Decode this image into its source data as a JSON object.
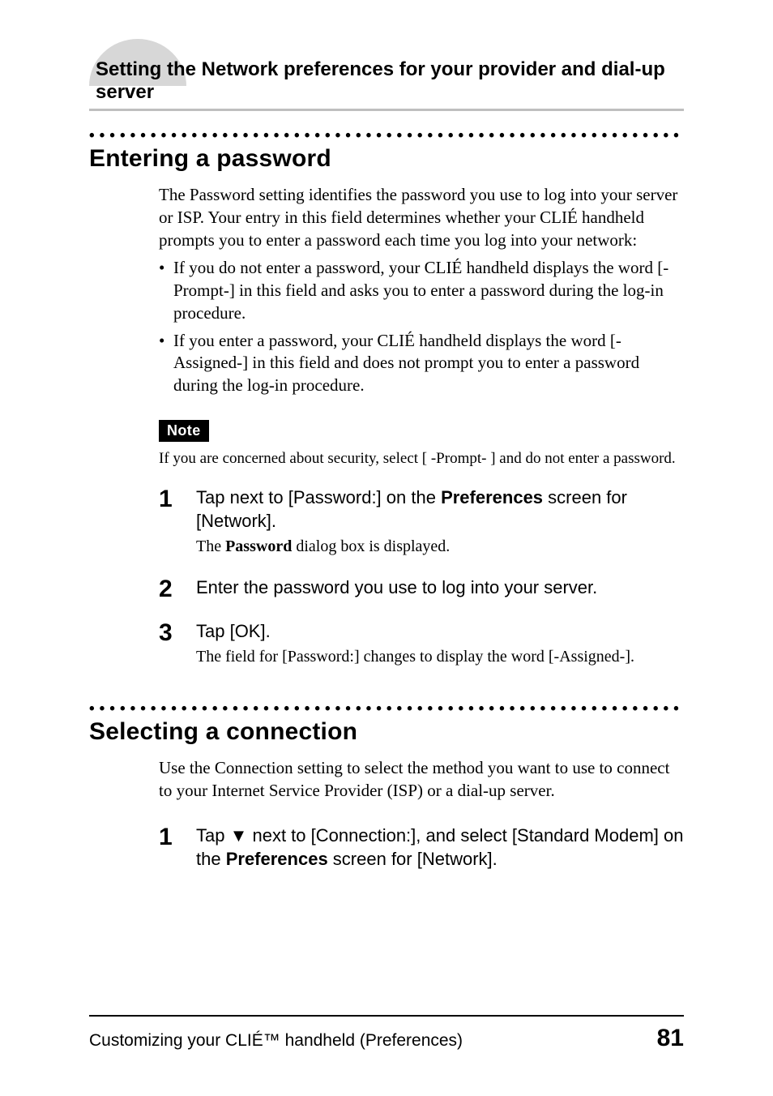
{
  "header": {
    "section_title": "Setting the Network preferences for your provider and dial-up server"
  },
  "section1": {
    "heading": "Entering a password",
    "intro": "The Password setting identifies the password you use to log into your server or ISP. Your entry in this field determines whether your CLIÉ handheld prompts you to enter a password each time you log into your network:",
    "bullets": [
      "If you do not enter a password, your CLIÉ handheld displays the word [-Prompt-] in this field and asks you to enter a password during the log-in procedure.",
      "If you enter a password, your CLIÉ handheld displays the word [-Assigned-] in this field and does not prompt you to enter a password during the log-in procedure."
    ],
    "note_label": "Note",
    "note_text": "If you are concerned about security, select [ -Prompt- ] and do not enter a password.",
    "steps": [
      {
        "num": "1",
        "line_pre": "Tap next to [Password:] on the ",
        "line_bold": "Preferences",
        "line_post": " screen for [Network].",
        "sub_pre": "The ",
        "sub_bold": "Password",
        "sub_post": " dialog box is displayed."
      },
      {
        "num": "2",
        "line_plain": "Enter the password you use to log into your server."
      },
      {
        "num": "3",
        "line_plain": "Tap [OK].",
        "sub_plain": "The field for [Password:] changes to display the word [-Assigned-]."
      }
    ]
  },
  "section2": {
    "heading": "Selecting a connection",
    "intro": "Use the Connection setting to select the method you want to use to connect to your Internet Service Provider (ISP) or a dial-up server.",
    "step1": {
      "num": "1",
      "pre": "Tap ",
      "tri": "▼",
      "mid": " next to [Connection:], and select [Standard Modem] on the ",
      "bold": "Preferences",
      "post": " screen for [Network]."
    }
  },
  "footer": {
    "left": "Customizing your CLIÉ™ handheld (Preferences)",
    "page": "81"
  },
  "dots": "••••••••••••••••••••••••••••••••••••••••••••••••••••••••••"
}
